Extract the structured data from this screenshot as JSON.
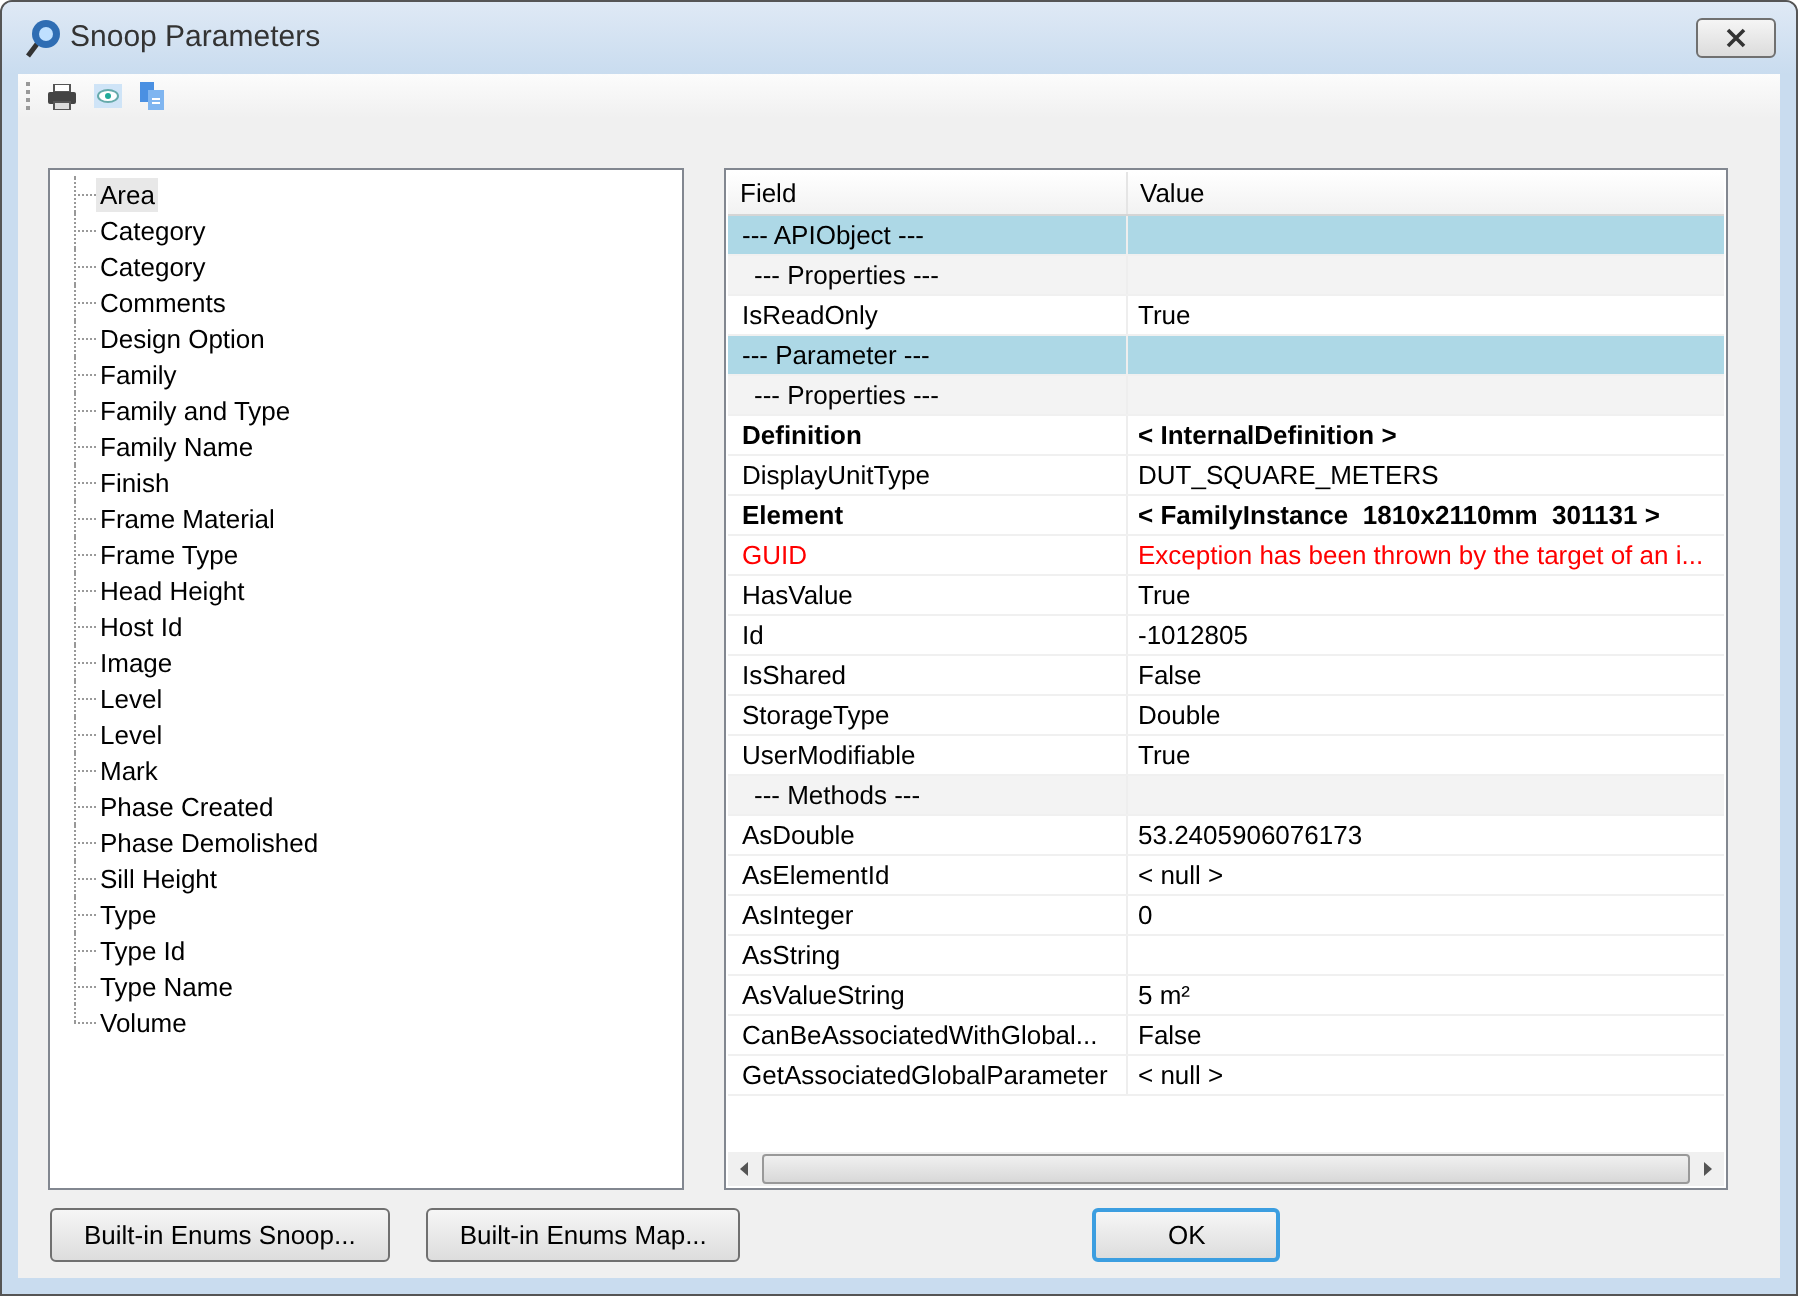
{
  "window": {
    "title": "Snoop Parameters"
  },
  "toolbar": [
    {
      "kind": "print"
    },
    {
      "kind": "preview"
    },
    {
      "kind": "copy"
    }
  ],
  "tree": {
    "items": [
      {
        "label": "Area",
        "selected": true
      },
      {
        "label": "Category",
        "selected": false
      },
      {
        "label": "Category",
        "selected": false
      },
      {
        "label": "Comments",
        "selected": false
      },
      {
        "label": "Design Option",
        "selected": false
      },
      {
        "label": "Family",
        "selected": false
      },
      {
        "label": "Family and Type",
        "selected": false
      },
      {
        "label": "Family Name",
        "selected": false
      },
      {
        "label": "Finish",
        "selected": false
      },
      {
        "label": "Frame Material",
        "selected": false
      },
      {
        "label": "Frame Type",
        "selected": false
      },
      {
        "label": "Head Height",
        "selected": false
      },
      {
        "label": "Host Id",
        "selected": false
      },
      {
        "label": "Image",
        "selected": false
      },
      {
        "label": "Level",
        "selected": false
      },
      {
        "label": "Level",
        "selected": false
      },
      {
        "label": "Mark",
        "selected": false
      },
      {
        "label": "Phase Created",
        "selected": false
      },
      {
        "label": "Phase Demolished",
        "selected": false
      },
      {
        "label": "Sill Height",
        "selected": false
      },
      {
        "label": "Type",
        "selected": false
      },
      {
        "label": "Type Id",
        "selected": false
      },
      {
        "label": "Type Name",
        "selected": false
      },
      {
        "label": "Volume",
        "selected": false
      }
    ]
  },
  "table": {
    "columns": [
      "Field",
      "Value"
    ],
    "rows": [
      {
        "kind": "section",
        "field": "--- APIObject ---"
      },
      {
        "kind": "group",
        "field": "--- Properties ---"
      },
      {
        "kind": "plain",
        "field": "IsReadOnly",
        "value": "True"
      },
      {
        "kind": "section",
        "field": "--- Parameter ---"
      },
      {
        "kind": "group",
        "field": "--- Properties ---"
      },
      {
        "kind": "bold",
        "field": "Definition",
        "value": "< InternalDefinition >"
      },
      {
        "kind": "plain",
        "field": "DisplayUnitType",
        "value": "DUT_SQUARE_METERS"
      },
      {
        "kind": "bold",
        "field": "Element",
        "value": "< FamilyInstance  1810x2110mm  301131 >"
      },
      {
        "kind": "error",
        "field": "GUID",
        "value": "Exception has been thrown by the target of an i..."
      },
      {
        "kind": "plain",
        "field": "HasValue",
        "value": "True"
      },
      {
        "kind": "plain",
        "field": "Id",
        "value": "-1012805"
      },
      {
        "kind": "plain",
        "field": "IsShared",
        "value": "False"
      },
      {
        "kind": "plain",
        "field": "StorageType",
        "value": "Double"
      },
      {
        "kind": "plain",
        "field": "UserModifiable",
        "value": "True"
      },
      {
        "kind": "group",
        "field": "--- Methods ---"
      },
      {
        "kind": "plain",
        "field": "AsDouble",
        "value": "53.2405906076173"
      },
      {
        "kind": "plain",
        "field": "AsElementId",
        "value": "< null >"
      },
      {
        "kind": "plain",
        "field": "AsInteger",
        "value": "0"
      },
      {
        "kind": "plain",
        "field": "AsString"
      },
      {
        "kind": "plain",
        "field": "AsValueString",
        "value": "5 m²"
      },
      {
        "kind": "plain",
        "field": "CanBeAssociatedWithGlobal...",
        "value": "False"
      },
      {
        "kind": "plain",
        "field": "GetAssociatedGlobalParameter",
        "value": "< null >"
      }
    ]
  },
  "buttons": [
    {
      "label": "Built-in Enums Snoop...",
      "kind": "normal"
    },
    {
      "label": "Built-in Enums Map...",
      "kind": "normal"
    },
    {
      "label": "OK",
      "kind": "default"
    }
  ]
}
